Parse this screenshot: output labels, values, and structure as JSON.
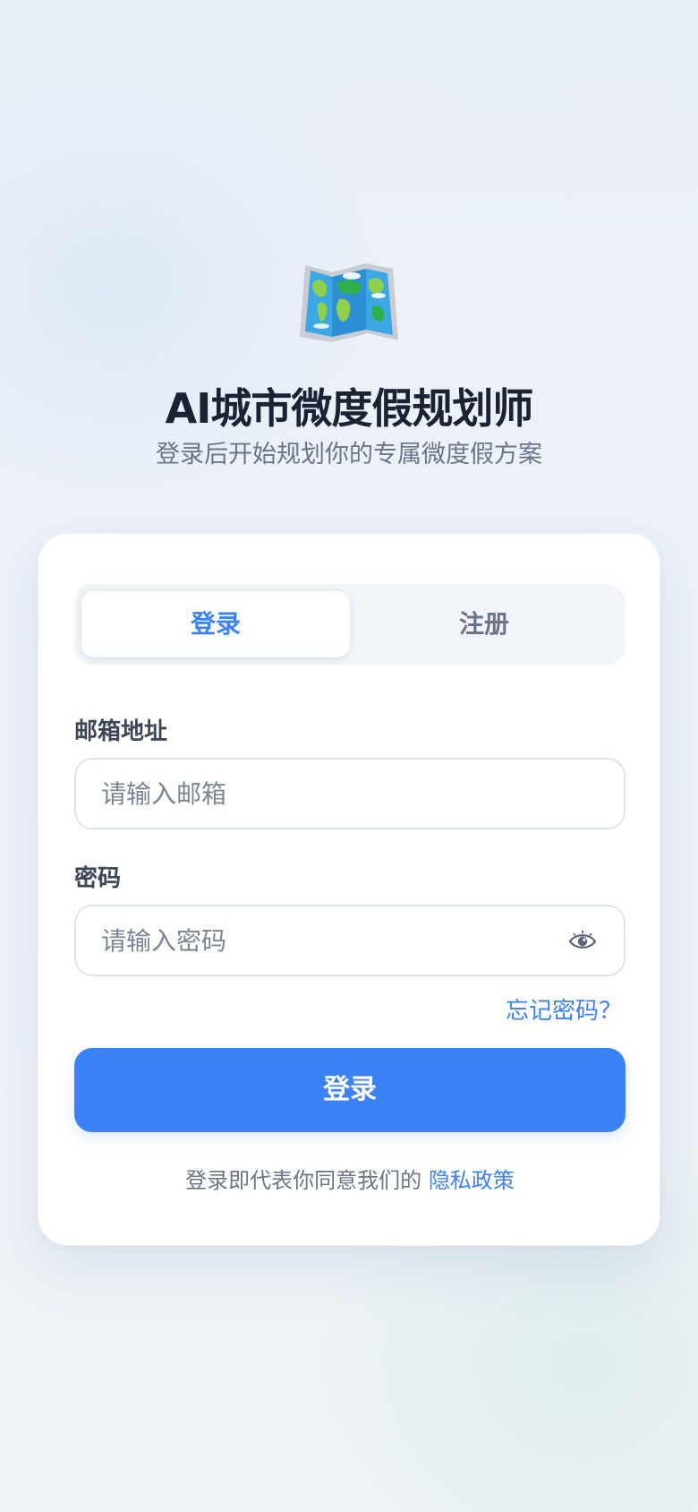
{
  "app": {
    "title": "AI城市微度假规划师",
    "subtitle": "登录后开始规划你的专属微度假方案",
    "logo_icon": "world-map-icon"
  },
  "tabs": [
    {
      "label": "登录",
      "active": true
    },
    {
      "label": "注册",
      "active": false
    }
  ],
  "form": {
    "email": {
      "label": "邮箱地址",
      "placeholder": "请输入邮箱",
      "value": ""
    },
    "password": {
      "label": "密码",
      "placeholder": "请输入密码",
      "value": "",
      "toggle_icon": "eye-icon"
    },
    "forgot_label": "忘记密码？",
    "submit_label": "登录"
  },
  "footer": {
    "agree_text": "登录即代表你同意我们的",
    "privacy_link": "隐私政策"
  },
  "colors": {
    "accent": "#3b82f6",
    "title": "#1a2233",
    "muted": "#6b7588"
  }
}
